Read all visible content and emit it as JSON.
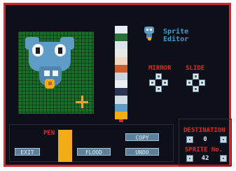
{
  "app": {
    "title_line1": "Sprite",
    "title_line2": "Editor"
  },
  "colors": {
    "frame": "#d8262a",
    "background": "#0d1018",
    "canvas_bg": "#1d6d2a",
    "label": "#dd2b28",
    "title": "#3e9ec8",
    "pen": "#f3ad14",
    "button": "#5c7f9c"
  },
  "palette": [
    "#e6eef3",
    "#2a6e3a",
    "#dbe4ea",
    "#e8e8e8",
    "#f1d8c4",
    "#cf5a2a",
    "#c9d6e0",
    "#ebeff2",
    "#2c3550",
    "#d3dde6",
    "#5f9dc6",
    "#f3ad14"
  ],
  "transform": {
    "mirror_label": "MIRROR",
    "slide_label": "SLIDE"
  },
  "pen": {
    "label": "PEN"
  },
  "buttons": {
    "exit": "EXIT",
    "flood": "FLOOD",
    "copy": "COPY",
    "undo": "UNDO"
  },
  "destination": {
    "label": "DESTINATION",
    "value": "0"
  },
  "sprite_no": {
    "label": "SPRITE No.",
    "value": "42"
  },
  "icons": {
    "cursor": "crosshair-icon",
    "mirror": "dpad-icon",
    "slide": "dpad-icon"
  }
}
